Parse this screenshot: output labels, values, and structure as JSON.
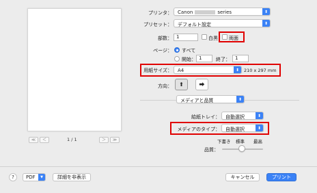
{
  "preview": {
    "page_indicator": "1 / 1"
  },
  "pager": {
    "first": "≪",
    "prev": "＜",
    "next": "＞",
    "last": "≫"
  },
  "printer": {
    "label": "プリンタ：",
    "value_prefix": "Canon",
    "value_suffix": "series"
  },
  "presets": {
    "label": "プリセット：",
    "value": "デフォルト設定"
  },
  "copies": {
    "label": "部数：",
    "value": "1",
    "bw_label": "白黒",
    "duplex_label": "両面"
  },
  "pages": {
    "label": "ページ：",
    "all_label": "すべて",
    "from_label": "開始：",
    "from_value": "1",
    "to_label": "終了：",
    "to_value": "1"
  },
  "paper_size": {
    "label": "用紙サイズ：",
    "value": "A4",
    "dimensions": "210 x 297 mm"
  },
  "orientation": {
    "label": "方向："
  },
  "section": {
    "value": "メディアと品質"
  },
  "paper_tray": {
    "label": "給紙トレイ：",
    "value": "自動選択"
  },
  "media_type": {
    "label": "メディアのタイプ：",
    "value": "自動選択"
  },
  "quality": {
    "label": "品質：",
    "ticks": [
      "下書き",
      "標準",
      "最高"
    ],
    "selected": "標準"
  },
  "bottom": {
    "help": "?",
    "pdf": "PDF",
    "hide_details": "詳細を非表示",
    "cancel": "キャンセル",
    "print": "プリント"
  },
  "colors": {
    "accent": "#3b82f6",
    "highlight": "#e00000"
  }
}
